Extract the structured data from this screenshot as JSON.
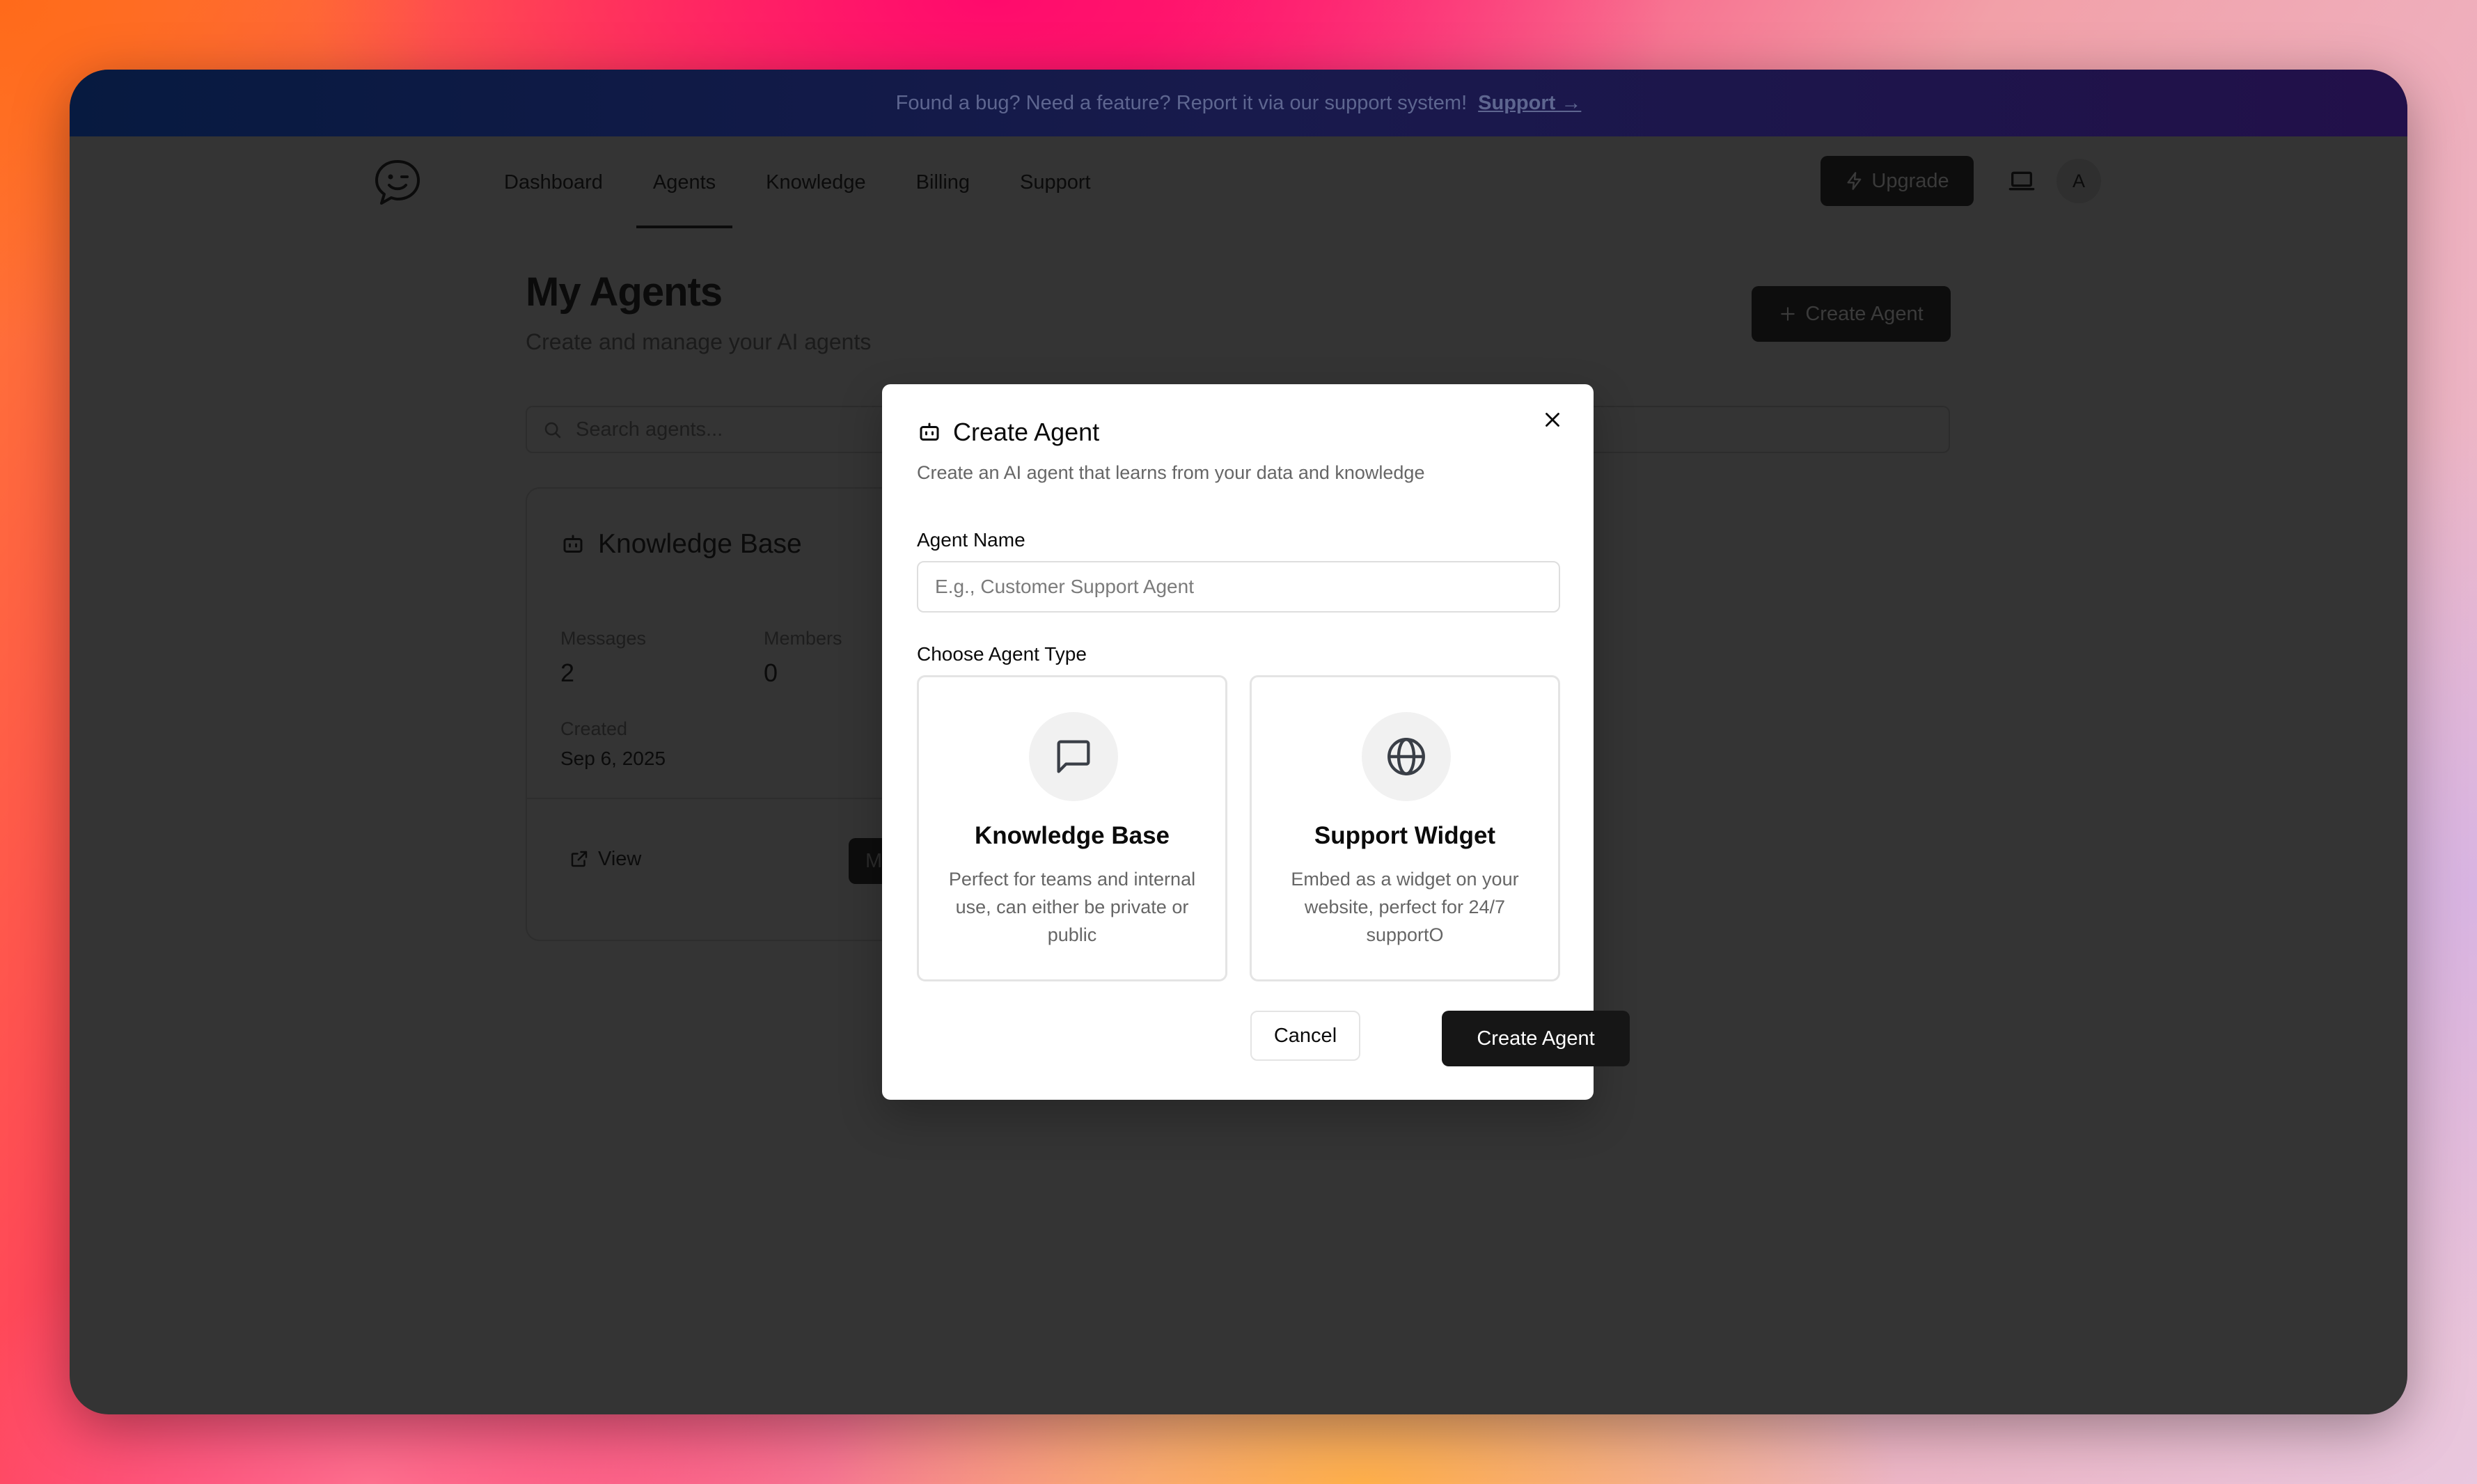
{
  "banner": {
    "text": "Found a bug? Need a feature? Report it via our support system!",
    "link_label": "Support →"
  },
  "nav": {
    "items": [
      {
        "label": "Dashboard"
      },
      {
        "label": "Agents",
        "active": true
      },
      {
        "label": "Knowledge"
      },
      {
        "label": "Billing"
      },
      {
        "label": "Support"
      }
    ],
    "upgrade_label": "Upgrade",
    "avatar_initial": "A"
  },
  "page": {
    "title": "My Agents",
    "subtitle": "Create and manage your AI agents",
    "create_button_label": "Create Agent",
    "search_placeholder": "Search agents..."
  },
  "agent_card": {
    "name": "Knowledge Base",
    "messages_label": "Messages",
    "messages_value": "2",
    "members_label": "Members",
    "members_value": "0",
    "created_label": "Created",
    "created_value": "Sep 6, 2025",
    "view_label": "View",
    "manage_label": "M"
  },
  "modal": {
    "title": "Create Agent",
    "description": "Create an AI agent that learns from your data and knowledge",
    "name_label": "Agent Name",
    "name_placeholder": "E.g., Customer Support Agent",
    "name_value": "",
    "type_label": "Choose Agent Type",
    "types": [
      {
        "title": "Knowledge Base",
        "description": "Perfect for teams and internal use, can either be private or public",
        "icon": "message-square-icon"
      },
      {
        "title": "Support Widget",
        "description": "Embed as a widget on your website, perfect for 24/7 supportO",
        "icon": "globe-icon"
      }
    ],
    "cancel_label": "Cancel",
    "submit_label": "Create Agent"
  },
  "colors": {
    "overlay_bg": "#343434",
    "primary_button": "#161616",
    "banner_start": "#071a40",
    "banner_end": "#22104a"
  }
}
